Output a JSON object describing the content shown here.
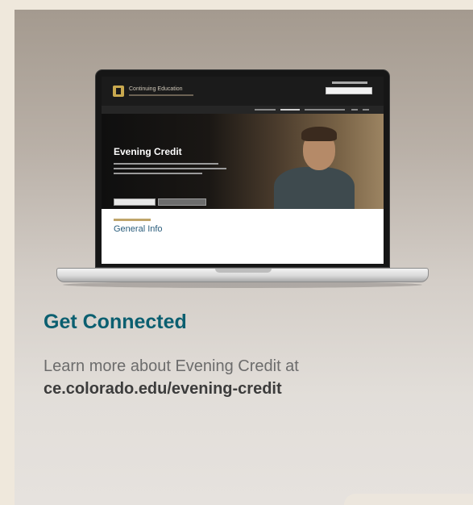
{
  "laptop_screen": {
    "brand": "Continuing Education",
    "hero_title": "Evening Credit",
    "section_heading": "General Info"
  },
  "card": {
    "title": "Get Connected",
    "body": "Learn more about Evening Credit at",
    "link": "ce.colorado.edu/evening-credit"
  },
  "colors": {
    "title": "#0b5f70",
    "body": "#6c6c6c",
    "link": "#3c3c3c",
    "background": "#efe8dc"
  }
}
